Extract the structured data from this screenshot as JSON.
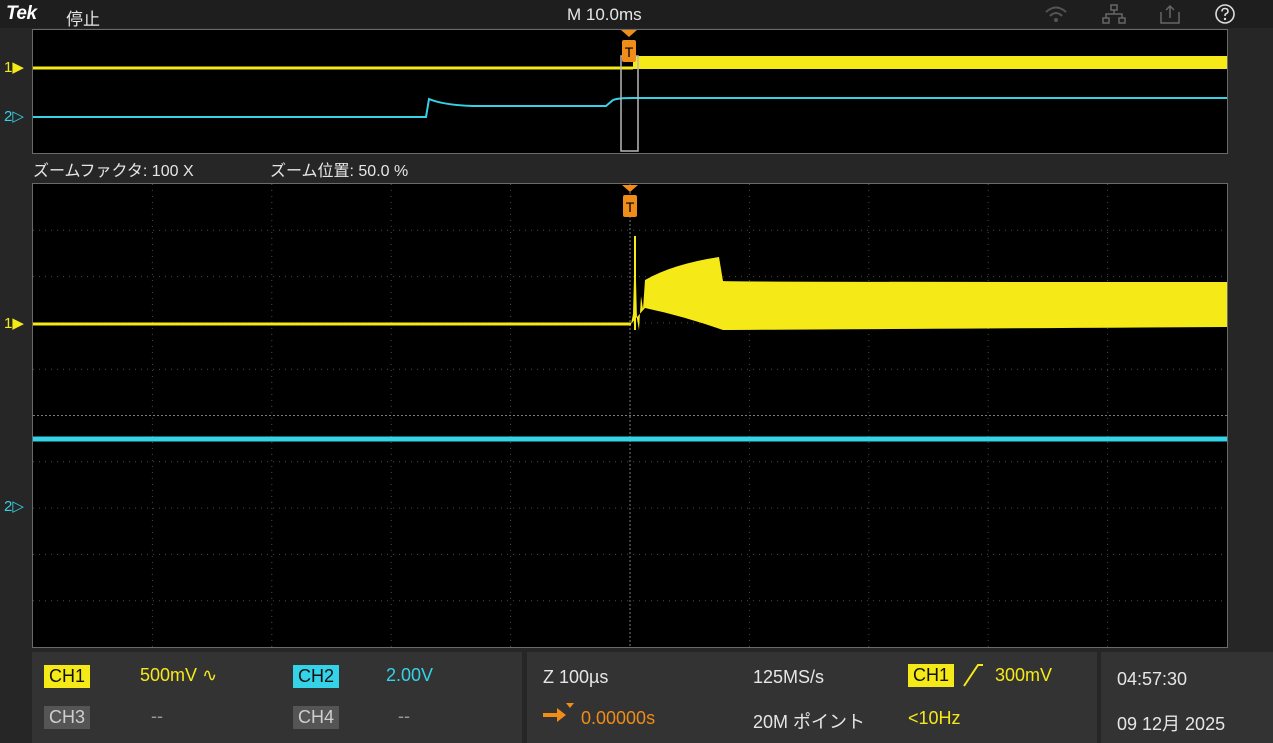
{
  "topbar": {
    "brand": "Tek",
    "status": "停止",
    "timebase": "M 10.0ms",
    "icons": [
      "wifi-icon",
      "network-icon",
      "export-icon",
      "help-icon"
    ]
  },
  "zoom": {
    "factor_label": "ズームファクタ: 100 X",
    "position_label": "ズーム位置: 50.0 %"
  },
  "markers": {
    "ch1": "1",
    "ch2": "2",
    "trigger": "T"
  },
  "channels": {
    "ch1": {
      "label": "CH1",
      "scale": "500mV",
      "color": "#f5ea17"
    },
    "ch2": {
      "label": "CH2",
      "scale": "2.00V",
      "color": "#35d3e8"
    },
    "ch3": {
      "label": "CH3",
      "scale": "--"
    },
    "ch4": {
      "label": "CH4",
      "scale": "--"
    }
  },
  "horizontal": {
    "zoom_scale": "Z 100µs",
    "sample_rate": "125MS/s",
    "position": "0.00000s",
    "record_length": "20M ポイント"
  },
  "trigger": {
    "source": "CH1",
    "level": "300mV",
    "frequency": "<10Hz"
  },
  "datetime": {
    "time": "04:57:30",
    "date": "09 12月 2025"
  }
}
